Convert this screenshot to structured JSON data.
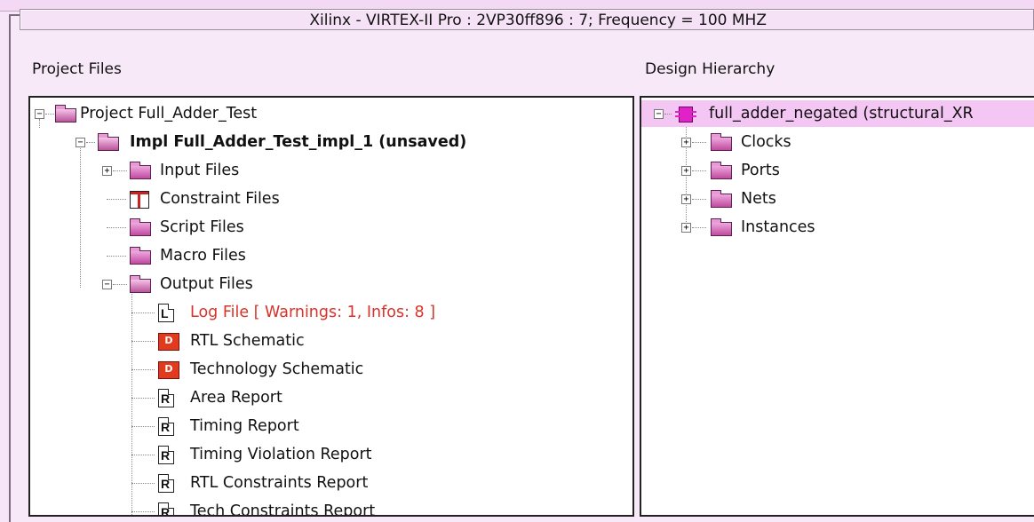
{
  "header": {
    "device_info": "Xilinx - VIRTEX-II Pro : 2VP30ff896 : 7; Frequency = 100 MHZ"
  },
  "left_panel": {
    "title": "Project Files",
    "items": [
      {
        "label": "Project Full_Adder_Test",
        "icon": "folder-open-icon",
        "expanded": true
      },
      {
        "label": "Impl Full_Adder_Test_impl_1 (unsaved)",
        "icon": "folder-open-icon",
        "expanded": true
      },
      {
        "label": "Input Files",
        "icon": "folder-icon",
        "expanded": false
      },
      {
        "label": "Constraint Files",
        "icon": "table-icon"
      },
      {
        "label": "Script Files",
        "icon": "folder-icon"
      },
      {
        "label": "Macro Files",
        "icon": "folder-icon"
      },
      {
        "label": "Output Files",
        "icon": "folder-open-icon",
        "expanded": true
      },
      {
        "label": "Log File [ Warnings: 1, Infos: 8 ]",
        "icon": "log-file-icon",
        "color": "#d8332a"
      },
      {
        "label": "RTL Schematic",
        "icon": "schematic-icon"
      },
      {
        "label": "Technology Schematic",
        "icon": "schematic-icon"
      },
      {
        "label": "Area Report",
        "icon": "report-icon"
      },
      {
        "label": "Timing Report",
        "icon": "report-icon"
      },
      {
        "label": "Timing Violation Report",
        "icon": "report-icon"
      },
      {
        "label": "RTL Constraints Report",
        "icon": "report-icon"
      },
      {
        "label": "Tech Constraints Report",
        "icon": "report-icon"
      }
    ]
  },
  "right_panel": {
    "title": "Design Hierarchy",
    "items": [
      {
        "label": "full_adder_negated (structural_XR",
        "icon": "design-block-icon",
        "expanded": true
      },
      {
        "label": "Clocks",
        "icon": "clock-folder-icon",
        "expanded": false
      },
      {
        "label": "Ports",
        "icon": "folder-icon",
        "expanded": false
      },
      {
        "label": "Nets",
        "icon": "folder-icon",
        "expanded": false
      },
      {
        "label": "Instances",
        "icon": "folder-icon",
        "expanded": false
      }
    ]
  },
  "colors": {
    "background": "#f6e6f8",
    "warning_text": "#d8332a",
    "selection": "#f4c6f4"
  }
}
